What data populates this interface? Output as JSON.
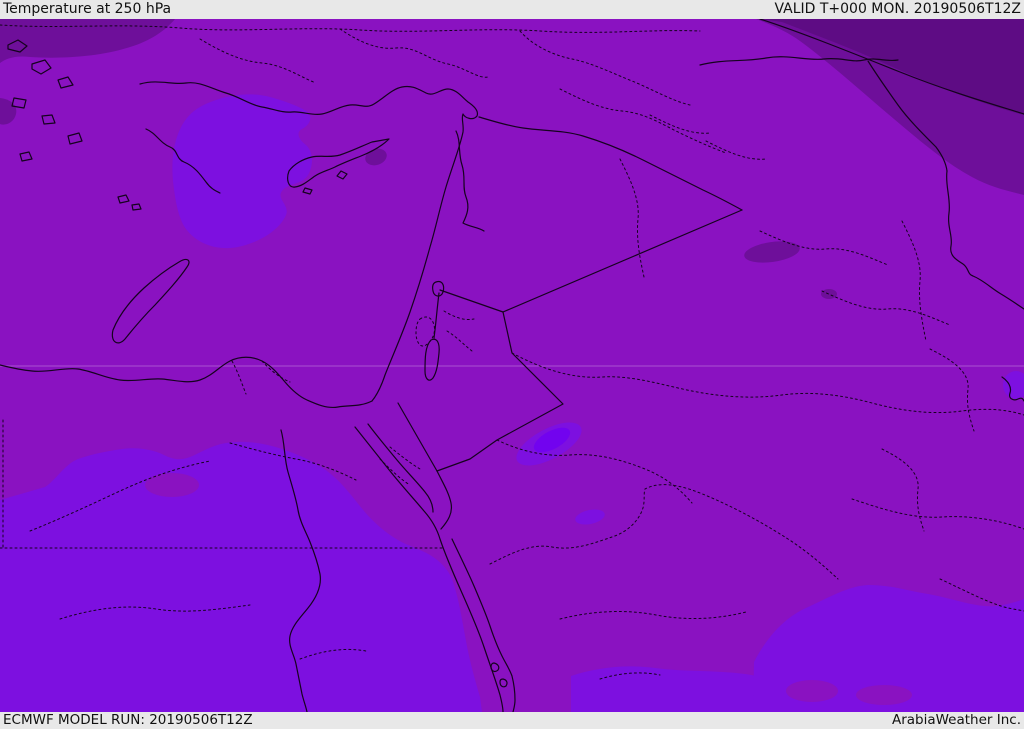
{
  "header": {
    "title": "Temperature at 250 hPa",
    "valid": "VALID T+000 MON. 20190506T12Z"
  },
  "footer": {
    "model_run": "ECMWF MODEL RUN: 20190506T12Z",
    "credit": "ArabiaWeather Inc."
  },
  "map": {
    "type": "weather-temperature-shading-map",
    "region": "Eastern Mediterranean / Middle East",
    "colors": {
      "bar_bg": "#e8e8e8",
      "bar_text": "#111111",
      "shade_base": "#8a12c1",
      "shade_dark": "#6e0f9a",
      "shade_darkest": "#5e0c84",
      "shade_bright": "#7d10e0",
      "shade_brightest": "#7203ef",
      "line": "#16021f",
      "graticule": "rgba(255,255,255,0.18)"
    }
  }
}
